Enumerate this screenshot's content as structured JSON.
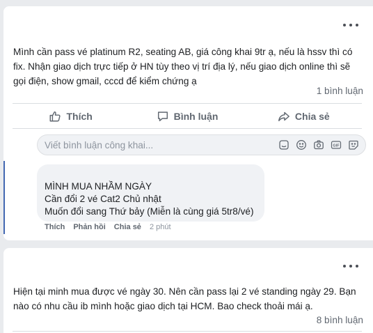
{
  "post1": {
    "text": "Mình cần pass vé platinum R2, seating AB, giá công khai 9tr ạ, nếu là hssv thì có fix. Nhận giao dịch trực tiếp ở HN tùy theo vị trí địa lý, nếu giao dịch online thì sẽ gọi điện, show gmail, cccd để kiểm chứng ạ",
    "comment_count": "1 bình luận",
    "actions": {
      "like": "Thích",
      "comment": "Bình luận",
      "share": "Chia sẻ"
    },
    "comment_input": {
      "placeholder": "Viết bình luận công khai..."
    },
    "reply": {
      "lines": [
        "MÌNH MUA NHẦM NGÀY",
        "Cần đổi 2 vé Cat2 Chủ nhật",
        "Muốn đổi sang Thứ bảy (Miễn là cùng giá 5tr8/vé)"
      ],
      "like": "Thích",
      "reply": "Phản hồi",
      "share": "Chia sẻ",
      "time": "2 phút"
    }
  },
  "post2": {
    "text": "Hiện tại minh mua được vé ngày 30. Nên cần pass lại 2 vé standing ngày 29. Bạn nào có nhu cầu ib mình hoặc giao dịch tại HCM. Bao check thoải mái ạ.",
    "comment_count": "8 bình luận"
  },
  "icons": [
    "more-icon",
    "like-icon",
    "comment-icon",
    "share-icon",
    "sticker-icon",
    "emoji-icon",
    "camera-icon",
    "gif-icon",
    "avatar-sticker-icon"
  ],
  "colors": {
    "accent": "#4267b2",
    "text": "#1c1e21",
    "muted": "#606770",
    "background": "#e9ebee"
  }
}
